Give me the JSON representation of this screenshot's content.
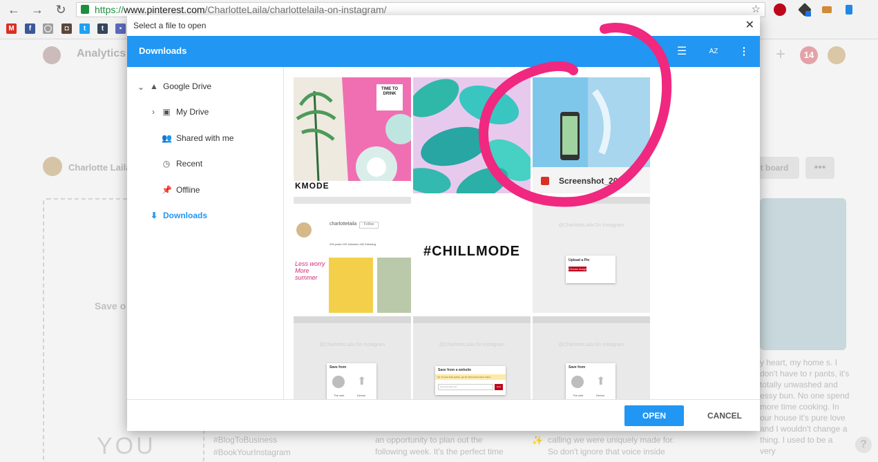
{
  "browser": {
    "url_scheme": "https://",
    "url_host": "www.pinterest.com",
    "url_path": "/CharlotteLaila/charlottelaila-on-instagram/"
  },
  "bookmarks": [
    {
      "icon": "gmail-icon",
      "glyph": "M",
      "color": "#d93025"
    },
    {
      "icon": "facebook-icon",
      "glyph": "f",
      "color": "#3b5998"
    },
    {
      "icon": "globe-icon",
      "glyph": "◯",
      "color": "#9e9e9e"
    },
    {
      "icon": "instagram-icon",
      "glyph": "◘",
      "color": "#5b4638"
    },
    {
      "icon": "twitter-icon",
      "glyph": "t",
      "color": "#1da1f2"
    },
    {
      "icon": "tumblr-icon",
      "glyph": "t",
      "color": "#35465c"
    },
    {
      "icon": "bookmark-icon",
      "glyph": "▪",
      "color": "#5c6bc0"
    }
  ],
  "page": {
    "nav_title": "Analytics",
    "notification_count": "14",
    "profile_name": "Charlotte Laila",
    "board_button": "t board",
    "save_text": "Save o",
    "article_text": "y heart, my home s. I don't have to r pants, it's totally unwashed and essy bun. No one spend more time cooking. In our house it's pure love and I wouldn't change a thing. I used to be a very",
    "col2_text": "an opportunity to plan out the following week. It's the perfect time",
    "col3_text": "calling we were uniquely made for. So don't ignore that voice inside",
    "col3_emoji": "✨",
    "tag1": "#BlogToBusiness",
    "tag2": "#BookYourInstagram",
    "you_text": "YOU"
  },
  "dialog": {
    "title": "Select a file to open",
    "folder_name": "Downloads",
    "sort_label": "AZ",
    "nav": {
      "google_drive": "Google Drive",
      "my_drive": "My Drive",
      "shared_with_me": "Shared with me",
      "recent": "Recent",
      "offline": "Offline",
      "downloads": "Downloads"
    },
    "selected_file_label": "Screenshot_20...",
    "tile_text_chillmode": "#CHILLMODE",
    "tile_text_time_to_drink": "TIME TO DRINK",
    "tile_text_wkmode": "KMODE",
    "tile_profile_name": "charlottelaila",
    "tile_profile_button": "Follow",
    "tile_profile_stats": "296 posts   12K followers   182 following",
    "tile_less_text": "Less worry More summer",
    "tile_upload_title": "Upload a Pin",
    "tile_upload_button": "Choose image",
    "tile_save_from": "Save from",
    "tile_save_from_website": "Save from a website",
    "tile_save_from_tip": "Tip: To save links quicker, get the Pinterest browser button",
    "tile_on_instagram": "@CharlotteLaila On Instagram",
    "tile_next": "Next",
    "tile_url_hint": "www.example.com",
    "tile_device": "Device",
    "tile_web": "The web",
    "open_button": "OPEN",
    "cancel_button": "CANCEL"
  },
  "colors": {
    "accent": "#2196f3",
    "annotation": "#f0287f",
    "pinterest_red": "#bd081c"
  }
}
